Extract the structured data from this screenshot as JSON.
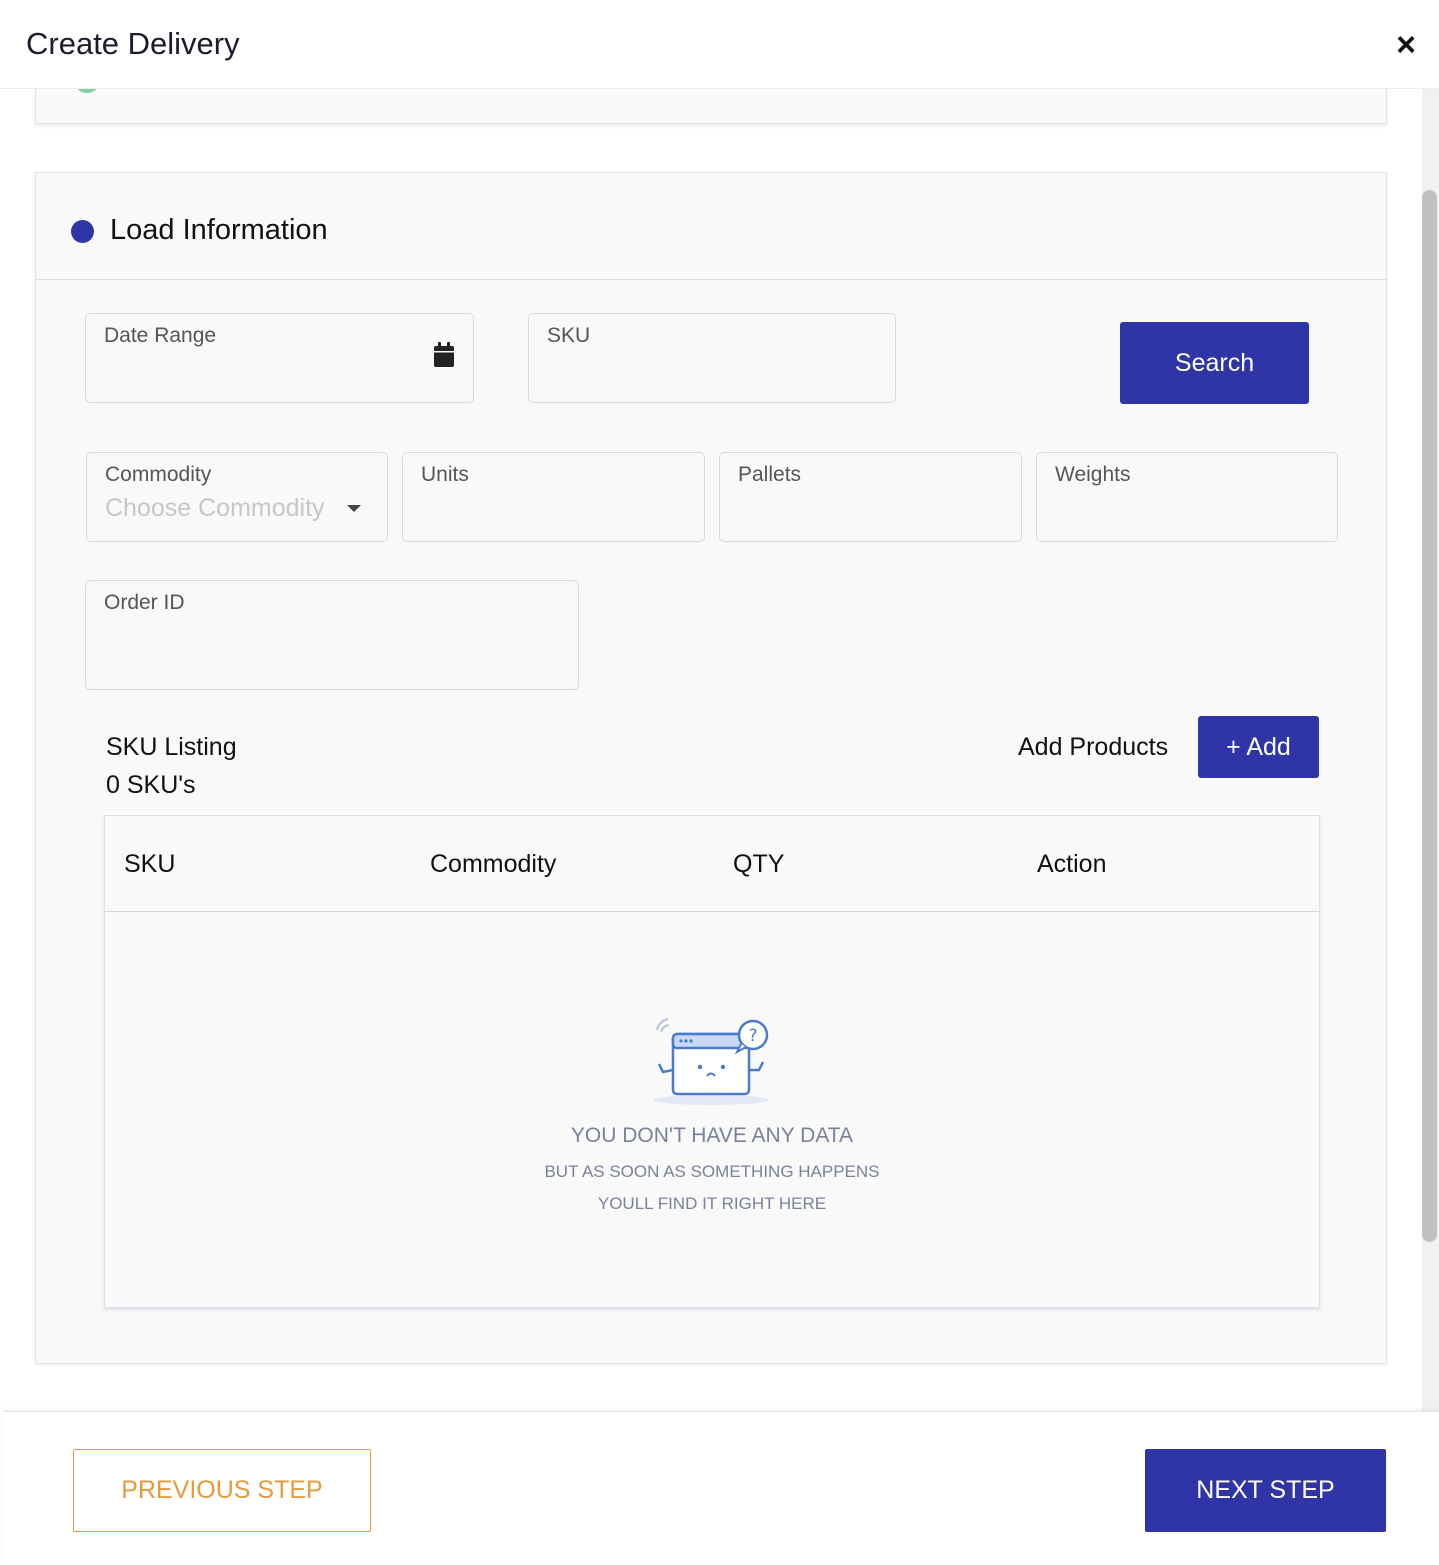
{
  "header": {
    "title": "Create Delivery",
    "close_glyph": "×"
  },
  "section": {
    "title": "Load Information"
  },
  "fields": {
    "date_range": {
      "label": "Date Range",
      "value": ""
    },
    "sku": {
      "label": "SKU",
      "value": ""
    },
    "commodity": {
      "label": "Commodity",
      "placeholder": "Choose Commodity"
    },
    "units": {
      "label": "Units",
      "value": ""
    },
    "pallets": {
      "label": "Pallets",
      "value": ""
    },
    "weights": {
      "label": "Weights",
      "value": ""
    },
    "order_id": {
      "label": "Order ID",
      "value": ""
    }
  },
  "search_button": "Search",
  "sku_listing": {
    "title": "SKU Listing",
    "count": "0 SKU's",
    "add_products_label": "Add Products",
    "add_button": "+ Add"
  },
  "table": {
    "columns": [
      "SKU",
      "Commodity",
      "QTY",
      "Action"
    ],
    "rows": [],
    "empty": {
      "title": "YOU DON'T HAVE ANY DATA",
      "line1": "BUT AS SOON AS SOMETHING HAPPENS",
      "line2": "YOULL FIND IT RIGHT HERE"
    }
  },
  "footer": {
    "previous": "PREVIOUS STEP",
    "next": "NEXT STEP"
  },
  "colors": {
    "primary": "#2f35a6",
    "accent_orange": "#e59a3c",
    "success_green": "#7fcfa1",
    "empty_text": "#7b8199"
  },
  "icons": {
    "close": "close-icon",
    "calendar": "calendar-icon",
    "dropdown": "chevron-down-icon",
    "empty": "empty-data-illustration"
  }
}
